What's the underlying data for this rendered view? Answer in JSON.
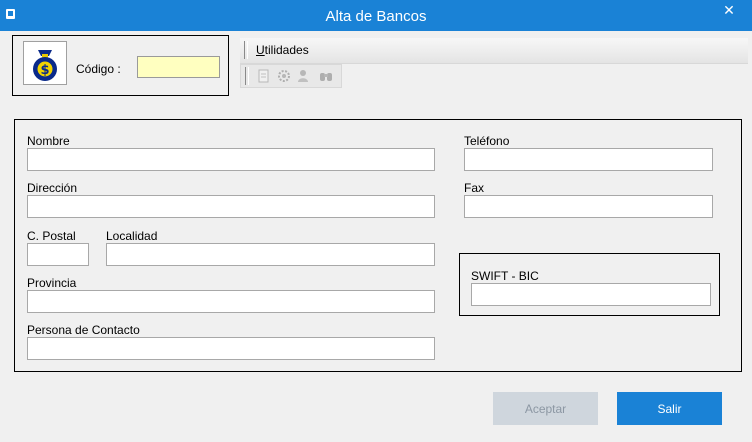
{
  "window": {
    "title": "Alta de Bancos",
    "close_glyph": "✕"
  },
  "header": {
    "logo_icon": "money-bag-dollar-icon",
    "code_label": "Código :",
    "code_value": ""
  },
  "menu": {
    "utilidades_underlined": "U",
    "utilidades_rest": "tilidades"
  },
  "toolbar": {
    "icons": [
      "document-icon",
      "gear-icon",
      "user-settings-icon",
      "binoculars-icon"
    ],
    "enabled": false
  },
  "form": {
    "nombre": {
      "label": "Nombre",
      "value": ""
    },
    "direccion": {
      "label": "Dirección",
      "value": ""
    },
    "cpostal": {
      "label": "C. Postal",
      "value": ""
    },
    "localidad": {
      "label": "Localidad",
      "value": ""
    },
    "provincia": {
      "label": "Provincia",
      "value": ""
    },
    "contacto": {
      "label": "Persona de Contacto",
      "value": ""
    },
    "telefono": {
      "label": "Teléfono",
      "value": ""
    },
    "fax": {
      "label": "Fax",
      "value": ""
    },
    "swift": {
      "label": "SWIFT - BIC",
      "value": ""
    }
  },
  "buttons": {
    "aceptar": "Aceptar",
    "salir": "Salir"
  },
  "colors": {
    "titlebar": "#1a82d6",
    "code_field": "#ffffc0",
    "primary_button": "#1a82d6",
    "disabled_button": "#cfd6dd"
  }
}
